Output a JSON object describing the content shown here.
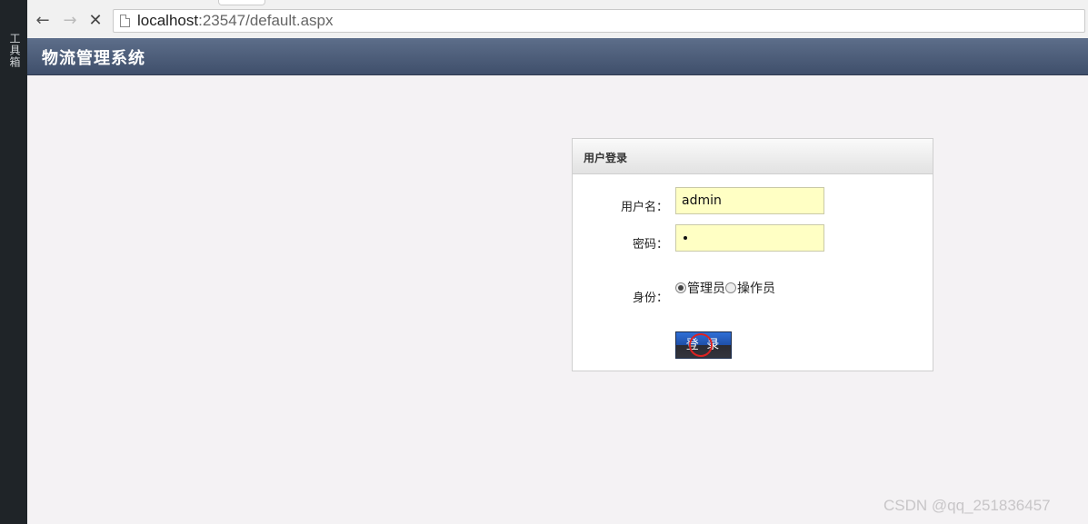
{
  "side_strip": {
    "label": "工具箱"
  },
  "browser": {
    "url_host": "localhost",
    "url_rest": ":23547/default.aspx"
  },
  "app": {
    "title": "物流管理系统"
  },
  "login": {
    "panel_title": "用户登录",
    "username_label": "用户名：",
    "username_value": "admin",
    "password_label": "密码：",
    "role_label": "身份：",
    "roles": [
      {
        "label": "管理员",
        "checked": true
      },
      {
        "label": "操作员",
        "checked": false
      }
    ],
    "submit_label": "登 录"
  },
  "watermark": "CSDN @qq_251836457",
  "colors": {
    "header_top": "#5d6e8a",
    "header_bottom": "#3f4f6b",
    "input_bg": "#ffffc4",
    "button_blue": "#2f6fd6"
  }
}
